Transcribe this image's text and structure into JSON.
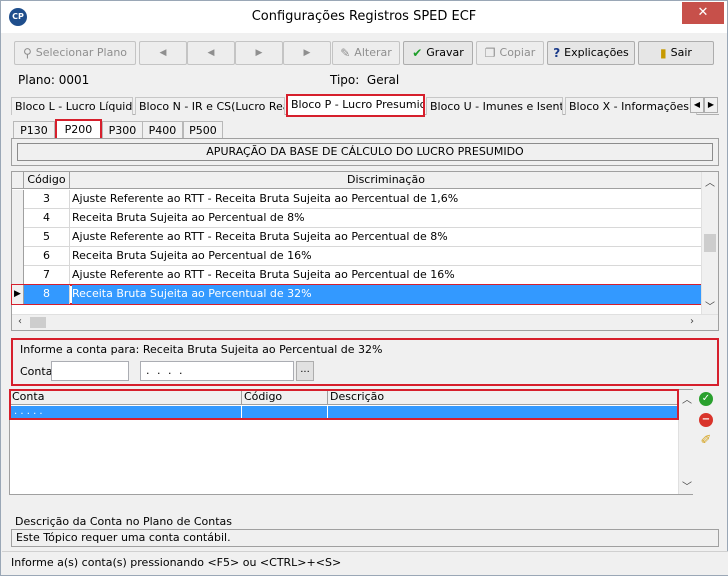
{
  "window": {
    "title": "Configurações Registros SPED ECF",
    "app_icon": "CP",
    "close_glyph": "✕"
  },
  "toolbar": {
    "selecionar_plano": "Selecionar Plano",
    "nav_first": "◀",
    "nav_prev": "◀",
    "nav_next": "▶",
    "nav_last": "▶",
    "alterar": "Alterar",
    "gravar": "Gravar",
    "copiar": "Copiar",
    "explicacoes": "Explicações",
    "sair": "Sair"
  },
  "info": {
    "plano": "Plano: 0001",
    "tipo": "Tipo:  Geral"
  },
  "bloco_tabs": [
    "Bloco L - Lucro Líquido",
    "Bloco N - IR e CS(Lucro Real)",
    "Bloco P - Lucro Presumido",
    "Bloco U - Imunes e Isentas",
    "Bloco X - Informações  E"
  ],
  "p_tabs": [
    "P130",
    "P200",
    "P300",
    "P400",
    "P500"
  ],
  "section_heading": "APURAÇÃO DA BASE DE CÁLCULO DO LUCRO PRESUMIDO",
  "grid": {
    "columns": [
      "Código",
      "Discriminação"
    ],
    "rows": [
      {
        "code": "3",
        "desc": "Ajuste Referente ao RTT - Receita Bruta Sujeita ao Percentual de 1,6%"
      },
      {
        "code": "4",
        "desc": "Receita Bruta Sujeita ao Percentual de 8%"
      },
      {
        "code": "5",
        "desc": "Ajuste Referente ao RTT - Receita Bruta Sujeita ao Percentual de 8%"
      },
      {
        "code": "6",
        "desc": "Receita Bruta Sujeita ao Percentual de 16%"
      },
      {
        "code": "7",
        "desc": "Ajuste Referente ao RTT - Receita Bruta Sujeita ao Percentual de 16%"
      },
      {
        "code": "8",
        "desc": "Receita Bruta Sujeita ao Percentual de 32%"
      }
    ],
    "selected_indicator": "▶"
  },
  "informe": {
    "title": "Informe a conta para: Receita Bruta Sujeita ao Percentual de 32%",
    "conta_label": "Conta",
    "conta_value": "",
    "mask_value": ". . . .",
    "browse_label": "..."
  },
  "grid2": {
    "columns": [
      "Conta",
      "Código Reduzido",
      "Descrição"
    ],
    "row_mask": ". . . . ."
  },
  "descricao_label": "Descrição da Conta no Plano de Contas",
  "descricao_text": "Este Tópico requer uma conta contábil.",
  "status": "Informe a(s) conta(s) pressionando <F5> ou <CTRL>+<S>",
  "colors": {
    "accent_red": "#d61f2c",
    "selection_blue": "#3399ff"
  }
}
